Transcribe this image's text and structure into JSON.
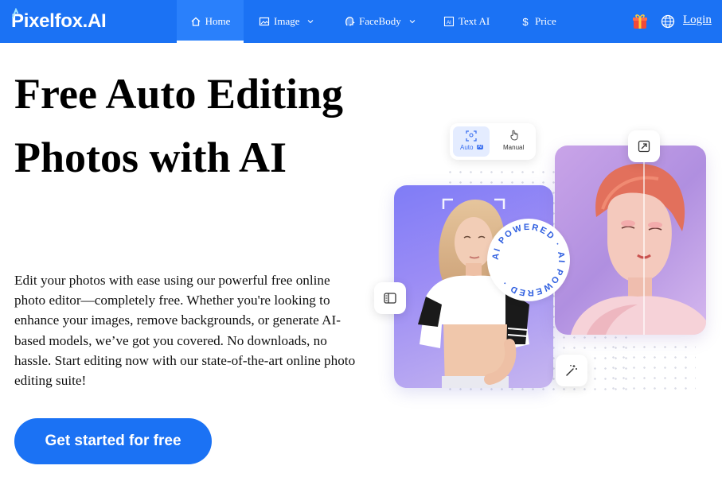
{
  "brand": {
    "name": "Pixelfox.AI",
    "color": "#1b72f4"
  },
  "nav": {
    "items": [
      {
        "label": "Home",
        "icon": "home-icon",
        "active": true
      },
      {
        "label": "Image",
        "icon": "image-icon",
        "dropdown": true
      },
      {
        "label": "FaceBody",
        "icon": "face-icon",
        "dropdown": true
      },
      {
        "label": "Text AI",
        "icon": "text-ai-icon"
      },
      {
        "label": "Price",
        "icon": "dollar-icon"
      }
    ],
    "gift_icon": "gift-icon",
    "language_icon": "globe-icon",
    "login_label": "Login"
  },
  "hero": {
    "title": "Free Auto Editing Photos with AI",
    "description": "Edit your photos with ease using our powerful free online photo editor—completely free. Whether you're looking to enhance your images, remove backgrounds, or generate AI-based models, we’ve got you covered. No downloads, no hassle. Start editing now with our state-of-the-art online photo editing suite!",
    "cta_label": "Get started for free"
  },
  "illustration": {
    "toggle_auto_label": "Auto",
    "toggle_ai_badge": "AI",
    "toggle_manual_label": "Manual",
    "badge_text": "AI POWERED · AI POWERED ·"
  }
}
